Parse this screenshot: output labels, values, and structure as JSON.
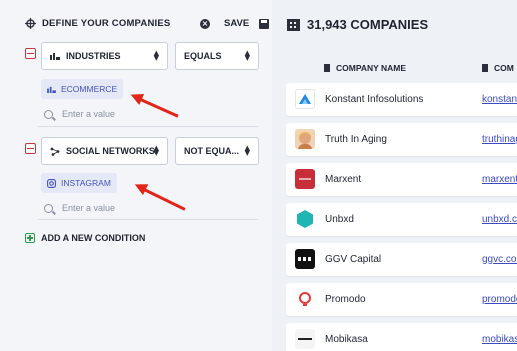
{
  "header": {
    "title": "DEFINE YOUR COMPANIES",
    "save_label": "SAVE"
  },
  "conditions": [
    {
      "field": "INDUSTRIES",
      "operator": "EQUALS",
      "value_chip": "ECOMMERCE",
      "search_placeholder": "Enter a value"
    },
    {
      "field": "SOCIAL NETWORKS",
      "operator": "NOT EQUA...",
      "value_chip": "INSTAGRAM",
      "search_placeholder": "Enter a value"
    }
  ],
  "add_condition_label": "ADD A NEW CONDITION",
  "results": {
    "count_label": "31,943 COMPANIES",
    "columns": [
      "COMPANY NAME",
      "COM"
    ],
    "rows": [
      {
        "name": "Konstant Infosolutions",
        "link": "konstant",
        "logo": "konstant-logo"
      },
      {
        "name": "Truth In Aging",
        "link": "truthinag",
        "logo": "truth-in-aging-logo"
      },
      {
        "name": "Marxent",
        "link": "marxent",
        "logo": "marxent-logo"
      },
      {
        "name": "Unbxd",
        "link": "unbxd.co",
        "logo": "unbxd-logo"
      },
      {
        "name": "GGV Capital",
        "link": "ggvc.com",
        "logo": "ggv-logo"
      },
      {
        "name": "Promodo",
        "link": "promodo",
        "logo": "promodo-logo"
      },
      {
        "name": "Mobikasa",
        "link": "mobikasa",
        "logo": "mobikasa-logo"
      }
    ]
  },
  "colors": {
    "accent": "#4552b8",
    "remove": "#c8363c",
    "add": "#2d9a4a",
    "annotation_arrow": "#e32519"
  }
}
